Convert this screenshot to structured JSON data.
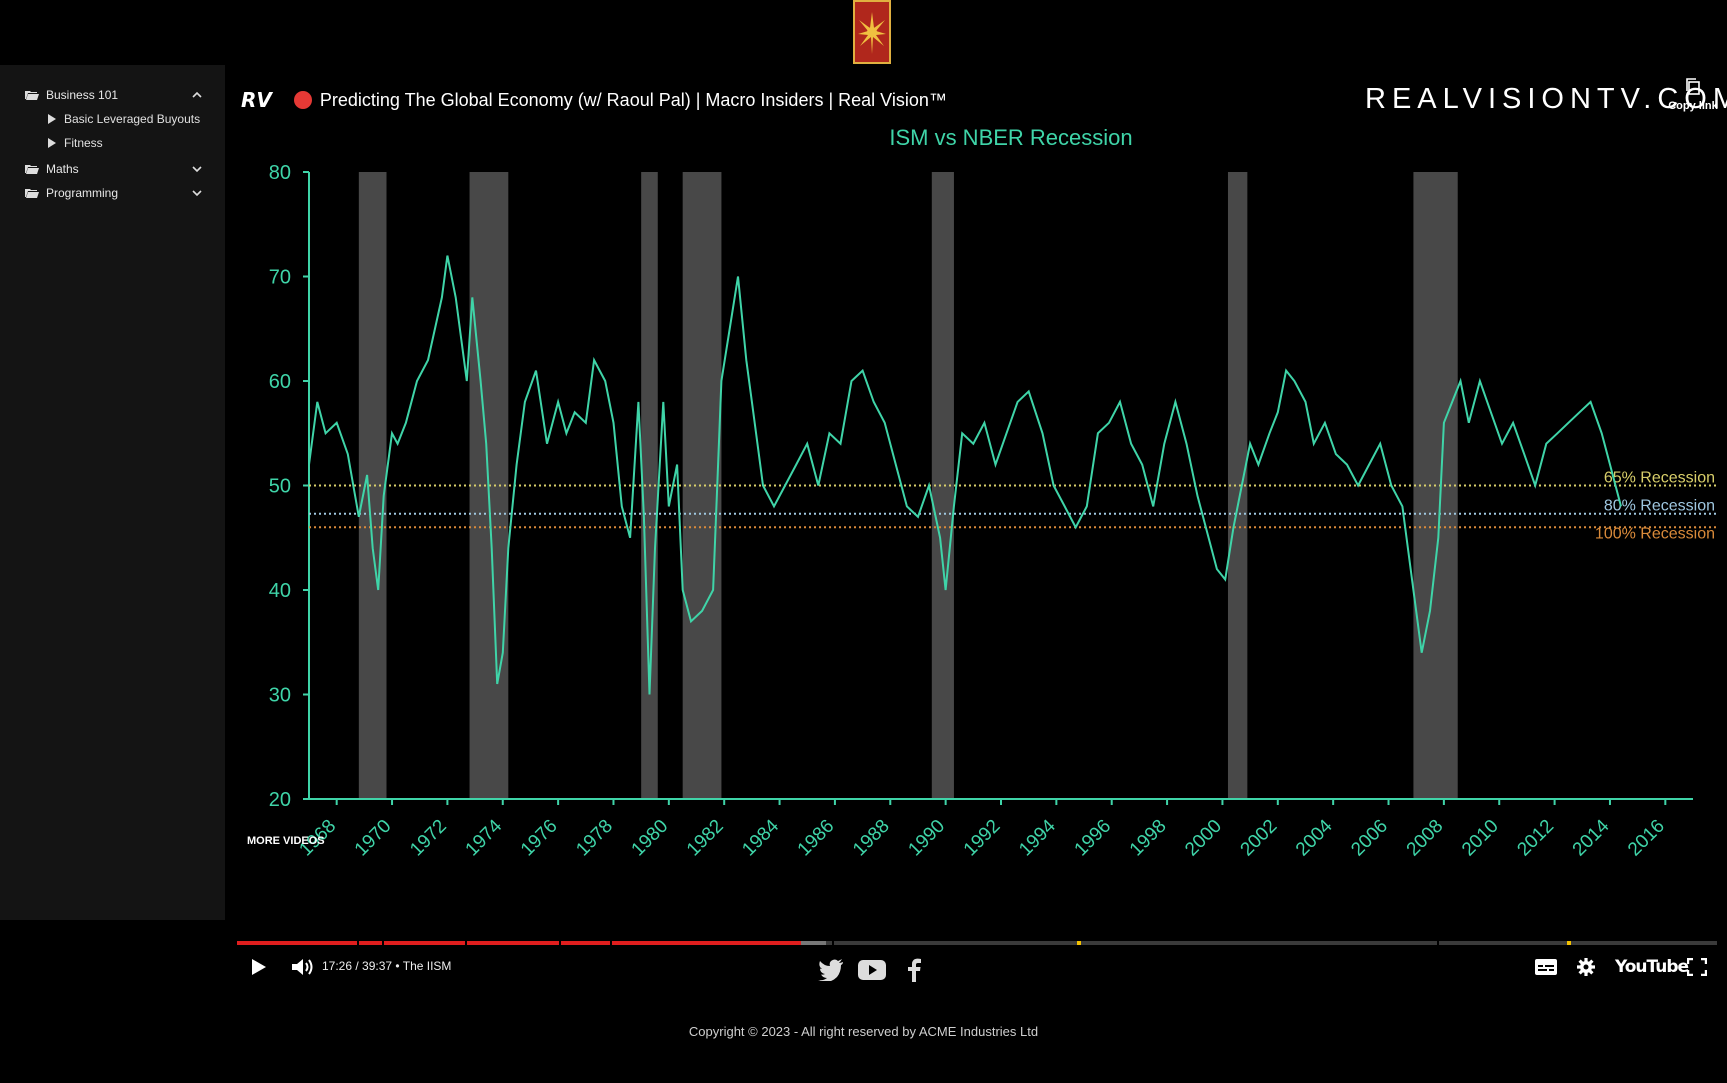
{
  "colors": {
    "accent": "#e01e1e",
    "chart_line": "#3fd4a8",
    "recession_band": "#555555"
  },
  "sidebar": {
    "items": [
      {
        "label": "Business 101",
        "expanded": true,
        "children": [
          "Basic Leveraged Buyouts",
          "Fitness"
        ]
      },
      {
        "label": "Maths",
        "expanded": false
      },
      {
        "label": "Programming",
        "expanded": false
      }
    ]
  },
  "video": {
    "channel_icon": "RV",
    "title": "Predicting The Global Economy (w/ Raoul Pal) | Macro Insiders | Real Vision™",
    "copy_link": "Copy link",
    "watermark": "REALVISIONTV.COM",
    "more_videos": "MORE VIDEOS",
    "time": "17:26 / 39:37",
    "chapter_sep": "•",
    "chapter": "The IISM",
    "youtube_label": "YouTube",
    "progress": {
      "played_fraction": 0.381,
      "buffered_fraction": 0.398
    }
  },
  "chart_data": {
    "type": "line",
    "title": "ISM vs NBER Recession",
    "ylim": [
      20,
      80
    ],
    "xlim": [
      1968,
      2018
    ],
    "yticks": [
      20,
      30,
      40,
      50,
      60,
      70,
      80
    ],
    "xtick_labels": [
      "1968",
      "1970",
      "1972",
      "1974",
      "1976",
      "1978",
      "1980",
      "1982",
      "1984",
      "1986",
      "1988",
      "1990",
      "1992",
      "1994",
      "1996",
      "1998",
      "2000",
      "2002",
      "2004",
      "2006",
      "2008",
      "2010",
      "2012",
      "2014",
      "2016"
    ],
    "recessions": [
      [
        1969.8,
        1970.8
      ],
      [
        1973.8,
        1975.2
      ],
      [
        1980.0,
        1980.6
      ],
      [
        1981.5,
        1982.9
      ],
      [
        1990.5,
        1991.3
      ],
      [
        2001.2,
        2001.9
      ],
      [
        2007.9,
        2009.5
      ]
    ],
    "threshold_lines": [
      {
        "label": "65% Recession",
        "value": 50.0,
        "color": "#d9cf6a"
      },
      {
        "label": "80% Recession",
        "value": 47.3,
        "color": "#9fc7e0"
      },
      {
        "label": "100% Recession",
        "value": 46.0,
        "color": "#d98a3a"
      }
    ],
    "series": [
      {
        "x": [
          1968.0,
          1968.3,
          1968.6,
          1969.0,
          1969.4,
          1969.8,
          1970.1,
          1970.3,
          1970.5,
          1970.7,
          1971.0,
          1971.2,
          1971.5,
          1971.9,
          1972.3,
          1972.8,
          1973.0,
          1973.3,
          1973.7,
          1973.9,
          1974.2,
          1974.4,
          1974.6,
          1974.8,
          1975.0,
          1975.2,
          1975.5,
          1975.8,
          1976.2,
          1976.6,
          1977.0,
          1977.3,
          1977.6,
          1978.0,
          1978.3,
          1978.7,
          1979.0,
          1979.3,
          1979.6,
          1979.9,
          1980.1,
          1980.3,
          1980.5,
          1980.8,
          1981.0,
          1981.3,
          1981.5,
          1981.8,
          1982.2,
          1982.6,
          1982.9,
          1983.2,
          1983.5,
          1983.8,
          1984.0,
          1984.4,
          1984.8,
          1985.2,
          1985.6,
          1986.0,
          1986.4,
          1986.8,
          1987.2,
          1987.6,
          1988.0,
          1988.4,
          1988.8,
          1989.2,
          1989.6,
          1990.0,
          1990.4,
          1990.8,
          1991.0,
          1991.3,
          1991.6,
          1992.0,
          1992.4,
          1992.8,
          1993.2,
          1993.6,
          1994.0,
          1994.5,
          1994.9,
          1995.3,
          1995.7,
          1996.1,
          1996.5,
          1996.9,
          1997.3,
          1997.7,
          1998.1,
          1998.5,
          1998.9,
          1999.3,
          1999.7,
          2000.1,
          2000.5,
          2000.8,
          2001.1,
          2001.4,
          2001.7,
          2002.0,
          2002.3,
          2002.7,
          2003.0,
          2003.3,
          2003.6,
          2004.0,
          2004.3,
          2004.7,
          2005.1,
          2005.5,
          2005.9,
          2006.3,
          2006.7,
          2007.1,
          2007.5,
          2007.9,
          2008.2,
          2008.5,
          2008.8,
          2009.0,
          2009.3,
          2009.6,
          2009.9,
          2010.3,
          2010.7,
          2011.1,
          2011.5,
          2011.9,
          2012.3,
          2012.7,
          2013.1,
          2013.5,
          2013.9,
          2014.3,
          2014.7,
          2015.0,
          2015.4
        ],
        "values": [
          52,
          58,
          55,
          56,
          53,
          47,
          51,
          44,
          40,
          49,
          55,
          54,
          56,
          60,
          62,
          68,
          72,
          68,
          60,
          68,
          60,
          54,
          44,
          31,
          34,
          44,
          52,
          58,
          61,
          54,
          58,
          55,
          57,
          56,
          62,
          60,
          56,
          48,
          45,
          58,
          47,
          30,
          44,
          58,
          48,
          52,
          40,
          37,
          38,
          40,
          60,
          65,
          70,
          62,
          58,
          50,
          48,
          50,
          52,
          54,
          50,
          55,
          54,
          60,
          61,
          58,
          56,
          52,
          48,
          47,
          50,
          45,
          40,
          48,
          55,
          54,
          56,
          52,
          55,
          58,
          59,
          55,
          50,
          48,
          46,
          48,
          55,
          56,
          58,
          54,
          52,
          48,
          54,
          58,
          54,
          49,
          45,
          42,
          41,
          46,
          50,
          54,
          52,
          55,
          57,
          61,
          60,
          58,
          54,
          56,
          53,
          52,
          50,
          52,
          54,
          50,
          48,
          40,
          34,
          38,
          45,
          56,
          58,
          60,
          56,
          60,
          57,
          54,
          56,
          53,
          50,
          54,
          55,
          56,
          57,
          58,
          55,
          52,
          48
        ]
      }
    ]
  },
  "footer": {
    "social_icons": [
      "twitter-icon",
      "youtube-icon",
      "facebook-icon"
    ],
    "copyright": "Copyright © 2023 - All right reserved by ACME Industries Ltd"
  }
}
